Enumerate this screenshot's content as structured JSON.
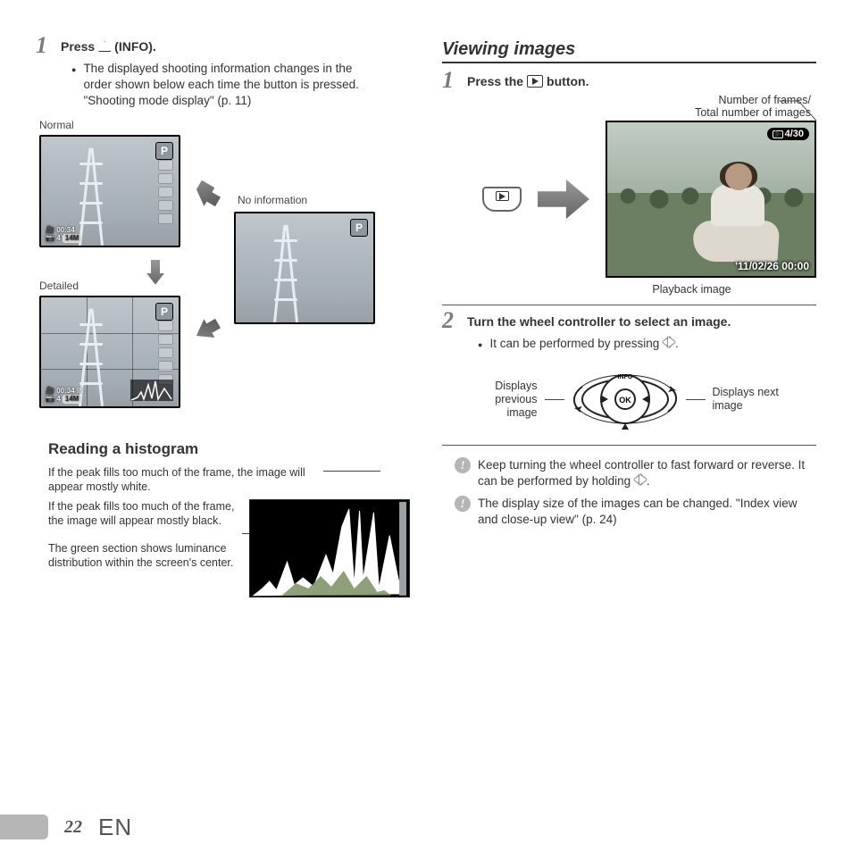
{
  "left": {
    "step1": {
      "num": "1",
      "title_pre": "Press",
      "title_post": "(INFO).",
      "bullet": "The displayed shooting information changes in the order shown below each time the button is pressed. \"Shooting mode display\" (p. 11)"
    },
    "labels": {
      "normal": "Normal",
      "no_info": "No information",
      "detailed": "Detailed",
      "p_mode": "P",
      "lcd_line1": "00:34",
      "lcd_line2_a": "4",
      "lcd_line2_b": "14M"
    },
    "histogram": {
      "heading": "Reading a histogram",
      "note_white": "If the peak fills too much of the frame, the image will appear mostly white.",
      "note_black": "If the peak fills too much of the frame, the image will appear mostly black.",
      "note_green": "The green section shows luminance distribution within the screen's center."
    }
  },
  "right": {
    "section": "Viewing images",
    "step1": {
      "num": "1",
      "title_pre": "Press the",
      "title_post": "button.",
      "label_count": "Number of frames/\nTotal number of images",
      "counter": "4/30",
      "date": "'11/02/26 00:00",
      "caption": "Playback image"
    },
    "step2": {
      "num": "2",
      "title": "Turn the wheel controller to select an image.",
      "bullet": "It can be performed by pressing",
      "left_label": "Displays previous image",
      "right_label": "Displays next image",
      "ok": "OK",
      "info": "INFO"
    },
    "notes": {
      "n1_a": "Keep turning the wheel controller to fast forward or reverse. It can be performed by holding",
      "n1_b": ".",
      "n2": "The display size of the images can be changed. \"Index view and close-up view\" (p. 24)"
    }
  },
  "footer": {
    "page": "22",
    "lang": "EN"
  }
}
